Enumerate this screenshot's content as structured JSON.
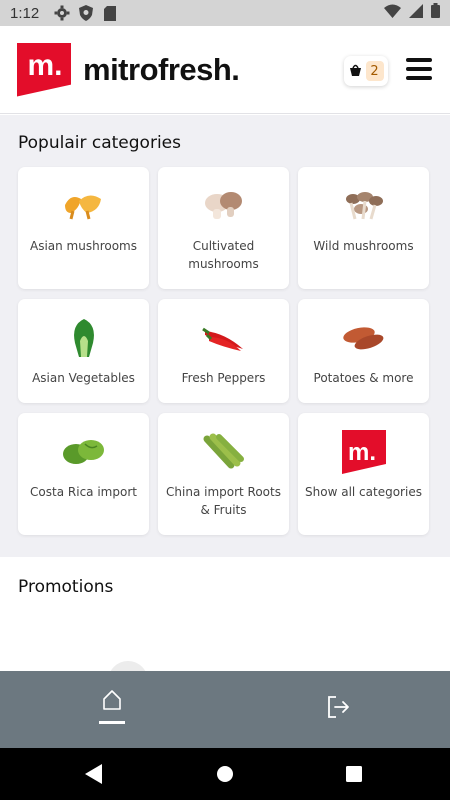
{
  "status_bar": {
    "time": "1:12",
    "icons": [
      "gear-icon",
      "shield-icon",
      "sd-card-icon",
      "wifi-icon",
      "cellular-signal-icon",
      "battery-icon"
    ]
  },
  "header": {
    "logo_mark": "m.",
    "logo_text": "mitrofresh.",
    "cart_count": "2",
    "brand_color": "#e30d2a"
  },
  "categories": {
    "title": "Populair categories",
    "items": [
      {
        "label": "Asian mushrooms",
        "icon": "asian-mushrooms-image"
      },
      {
        "label": "Cultivated mushrooms",
        "icon": "cultivated-mushrooms-image"
      },
      {
        "label": "Wild mushrooms",
        "icon": "wild-mushrooms-image"
      },
      {
        "label": "Asian Vegetables",
        "icon": "asian-vegetables-image"
      },
      {
        "label": "Fresh Peppers",
        "icon": "fresh-peppers-image"
      },
      {
        "label": "Potatoes & more",
        "icon": "potatoes-image"
      },
      {
        "label": "Costa Rica import",
        "icon": "costa-rica-image"
      },
      {
        "label": "China import Roots & Fruits",
        "icon": "china-roots-image"
      },
      {
        "label": "Show all categories",
        "icon": "mitrofresh-logo-icon"
      }
    ]
  },
  "promotions": {
    "title": "Promotions"
  },
  "bottom_nav": {
    "items": [
      "home-icon",
      "logout-icon"
    ],
    "active": "home"
  },
  "system_nav": [
    "back-icon",
    "home-circle-icon",
    "recents-icon"
  ]
}
